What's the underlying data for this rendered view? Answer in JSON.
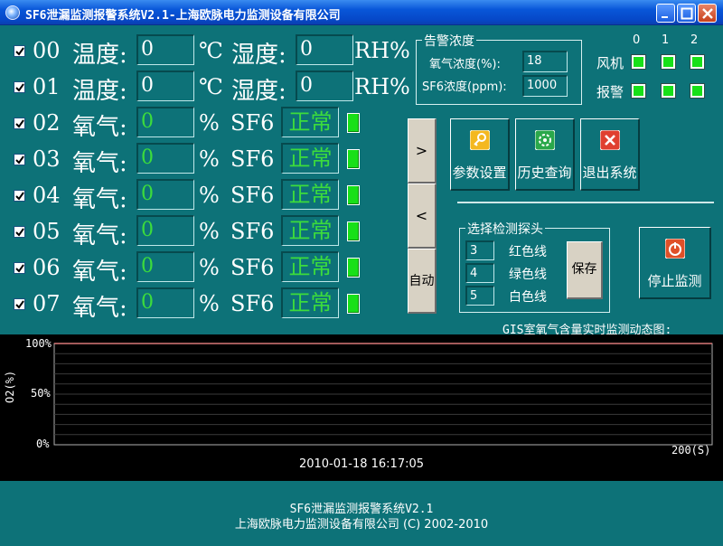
{
  "window": {
    "title": "SF6泄漏监测报警系统V2.1-上海欧脉电力监测设备有限公司"
  },
  "rows_th": [
    {
      "id": "00",
      "temp_label": "温度:",
      "temp_value": "0",
      "temp_unit": "℃",
      "hum_label": "湿度:",
      "hum_value": "0",
      "hum_unit": "RH%"
    },
    {
      "id": "01",
      "temp_label": "温度:",
      "temp_value": "0",
      "temp_unit": "℃",
      "hum_label": "湿度:",
      "hum_value": "0",
      "hum_unit": "RH%"
    }
  ],
  "rows_o2": [
    {
      "id": "02",
      "label": "氧气:",
      "value": "0",
      "unit": "%",
      "sf6_label": "SF6",
      "status": "正常"
    },
    {
      "id": "03",
      "label": "氧气:",
      "value": "0",
      "unit": "%",
      "sf6_label": "SF6",
      "status": "正常"
    },
    {
      "id": "04",
      "label": "氧气:",
      "value": "0",
      "unit": "%",
      "sf6_label": "SF6",
      "status": "正常"
    },
    {
      "id": "05",
      "label": "氧气:",
      "value": "0",
      "unit": "%",
      "sf6_label": "SF6",
      "status": "正常"
    },
    {
      "id": "06",
      "label": "氧气:",
      "value": "0",
      "unit": "%",
      "sf6_label": "SF6",
      "status": "正常"
    },
    {
      "id": "07",
      "label": "氧气:",
      "value": "0",
      "unit": "%",
      "sf6_label": "SF6",
      "status": "正常"
    }
  ],
  "alarm": {
    "title": "告警浓度",
    "o2_label": "氧气浓度(%):",
    "o2_value": "18",
    "sf6_label": "SF6浓度(ppm):",
    "sf6_value": "1000"
  },
  "fan_alarm": {
    "columns": [
      "0",
      "1",
      "2"
    ],
    "fan_label": "风机",
    "alarm_label": "报警"
  },
  "nav": {
    "next": ">",
    "prev": "<",
    "auto": "自动"
  },
  "actions": {
    "settings": "参数设置",
    "history": "历史查询",
    "exit": "退出系统",
    "stop": "停止监测"
  },
  "probe": {
    "title": "选择检测探头",
    "items": [
      {
        "value": "3",
        "label": "红色线"
      },
      {
        "value": "4",
        "label": "绿色线"
      },
      {
        "value": "5",
        "label": "白色线"
      }
    ],
    "save": "保存"
  },
  "chart_data": {
    "type": "line",
    "title": "GIS室氧气含量实时监测动态图:",
    "ylabel": "O2(%)",
    "xlabel": "",
    "y_ticks": [
      "100%",
      "50%",
      "0%"
    ],
    "ylim": [
      0,
      100
    ],
    "x_end_label": "200(S)",
    "xlim": [
      0,
      200
    ],
    "timestamp": "2010-01-18 16:17:05",
    "grid": true,
    "series": []
  },
  "footer": {
    "line1": "SF6泄漏监测报警系统V2.1",
    "line2": "上海欧脉电力监测设备有限公司 (C) 2002-2010"
  },
  "colors": {
    "background": "#0d7278",
    "value_green": "#3cdc3c",
    "led_green": "#18e018"
  }
}
